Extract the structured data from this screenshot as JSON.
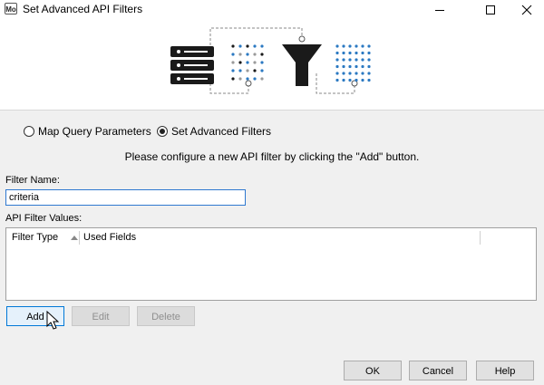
{
  "window": {
    "title": "Set Advanced API Filters",
    "app_icon_text": "Mo",
    "controls": [
      "minimize-icon",
      "maximize-icon",
      "close-icon"
    ]
  },
  "hero": {
    "icons": [
      "server-icon",
      "dot-matrix-icon",
      "funnel-icon",
      "blue-dot-grid-icon"
    ],
    "colors": {
      "dark": "#1a1a1a",
      "blue": "#2b79c2",
      "dashed": "#888888"
    }
  },
  "mode": {
    "option_map": "Map Query Parameters",
    "option_advanced": "Set Advanced Filters",
    "selected": "Set Advanced Filters"
  },
  "instruction": "Please configure a new API filter by clicking the \"Add\" button.",
  "filter_name": {
    "label": "Filter Name:",
    "value": "criteria"
  },
  "api_filter_values": {
    "label": "API Filter Values:",
    "columns": [
      "Filter Type",
      "Used Fields"
    ],
    "rows": []
  },
  "row_buttons": {
    "add": "Add",
    "edit": "Edit",
    "delete": "Delete"
  },
  "footer_buttons": {
    "ok": "OK",
    "cancel": "Cancel",
    "help": "Help"
  },
  "accent": "#0078d7"
}
